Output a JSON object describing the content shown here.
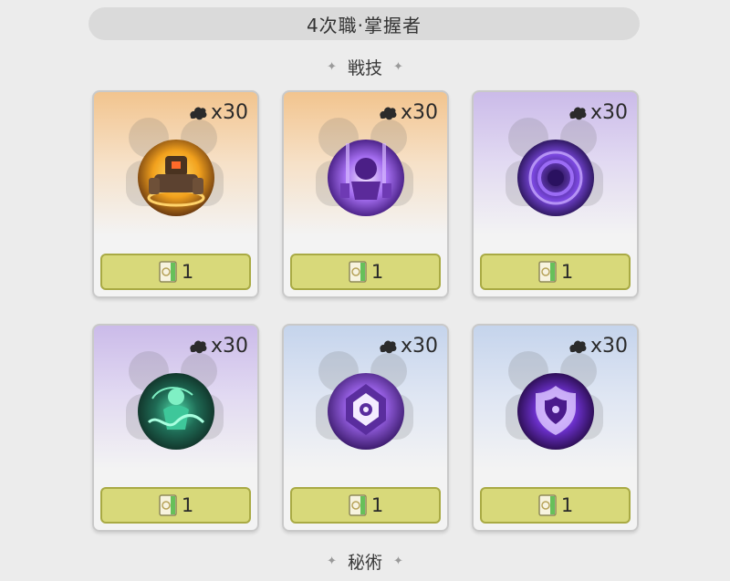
{
  "header": {
    "title": "4次職‧掌握者"
  },
  "sections": [
    {
      "label": "戦技"
    },
    {
      "label": "秘術"
    }
  ],
  "skills": [
    {
      "theme": "orange",
      "cost": "x30",
      "book_count": "1",
      "icon": "golem-skill-icon",
      "orb_colors": [
        "#ffb629",
        "#6b3a10"
      ]
    },
    {
      "theme": "orange",
      "cost": "x30",
      "book_count": "1",
      "icon": "purple-totem-skill-icon",
      "orb_colors": [
        "#b27af5",
        "#3a1474"
      ]
    },
    {
      "theme": "purple",
      "cost": "x30",
      "book_count": "1",
      "icon": "void-vortex-skill-icon",
      "orb_colors": [
        "#8e5cf0",
        "#1e0e44"
      ]
    },
    {
      "theme": "purple",
      "cost": "x30",
      "book_count": "1",
      "icon": "spirit-swirl-skill-icon",
      "orb_colors": [
        "#3ec79a",
        "#0f2c24"
      ]
    },
    {
      "theme": "blue",
      "cost": "x30",
      "book_count": "1",
      "icon": "rune-sigil-skill-icon",
      "orb_colors": [
        "#b788f2",
        "#3d1c6e"
      ]
    },
    {
      "theme": "blue",
      "cost": "x30",
      "book_count": "1",
      "icon": "shadow-shield-skill-icon",
      "orb_colors": [
        "#a06cf5",
        "#22093f"
      ]
    }
  ]
}
